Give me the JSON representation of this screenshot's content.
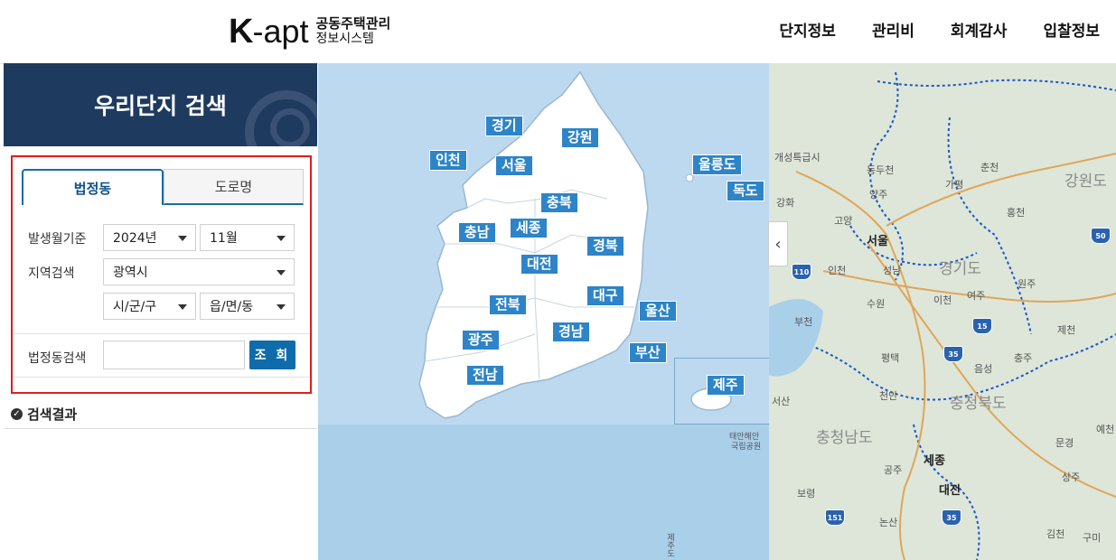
{
  "header": {
    "logo_k": "K",
    "logo_apt": "-apt",
    "logo_line1": "공동주택관리",
    "logo_line2": "정보시스템",
    "nav": [
      "단지정보",
      "관리비",
      "회계감사",
      "입찰정보"
    ]
  },
  "panel": {
    "title": "우리단지 검색",
    "tabs": [
      {
        "label": "법정동",
        "active": true
      },
      {
        "label": "도로명",
        "active": false
      }
    ],
    "period_label": "발생월기준",
    "year_value": "2024년",
    "month_value": "11월",
    "region_label": "지역검색",
    "sido_value": "광역시",
    "sigungu_value": "시/군/구",
    "dong_value": "읍/면/동",
    "dong_search_label": "법정동검색",
    "dong_search_value": "",
    "search_button": "조 회",
    "results_title": "검색결과"
  },
  "map": {
    "regions": [
      "경기",
      "강원",
      "인천",
      "서울",
      "울릉도",
      "독도",
      "충북",
      "세종",
      "충남",
      "경북",
      "대전",
      "대구",
      "전북",
      "울산",
      "경남",
      "광주",
      "부산",
      "전남",
      "제주"
    ],
    "labels": {
      "gaeseong": "개성특급시",
      "dongducheon": "동두천",
      "chuncheon": "춘천",
      "gangwon": "강원도",
      "yangju": "양주",
      "gapyeong": "가평",
      "ganghwa": "강화",
      "goyang": "고양",
      "seoul": "서울",
      "hongcheon": "홍천",
      "incheon": "인천",
      "seongnam": "성남",
      "gyeonggi": "경기도",
      "suwon": "수원",
      "icheon": "이천",
      "yeoju": "여주",
      "wonju": "원주",
      "jecheon": "제천",
      "pyeongtaek": "평택",
      "chungju": "충주",
      "eumseong": "음성",
      "cheonan": "천안",
      "chungbuk": "충청북도",
      "seosan": "서산",
      "yecheon": "예천",
      "chungnam": "충청남도",
      "mungyeong": "문경",
      "taean": "태안해안",
      "taean2": "국립공원",
      "gongju": "공주",
      "sejong": "세종",
      "sangju": "상주",
      "boryeong": "보령",
      "daejeon": "대전",
      "nonsan": "논산",
      "gimcheon": "김천",
      "gumi": "구미",
      "bucheon": "부천",
      "jeju_sea": "제주도"
    },
    "routes": [
      "110",
      "50",
      "15",
      "35",
      "151",
      "35"
    ],
    "toggle_icon": "chevron-left-icon"
  }
}
